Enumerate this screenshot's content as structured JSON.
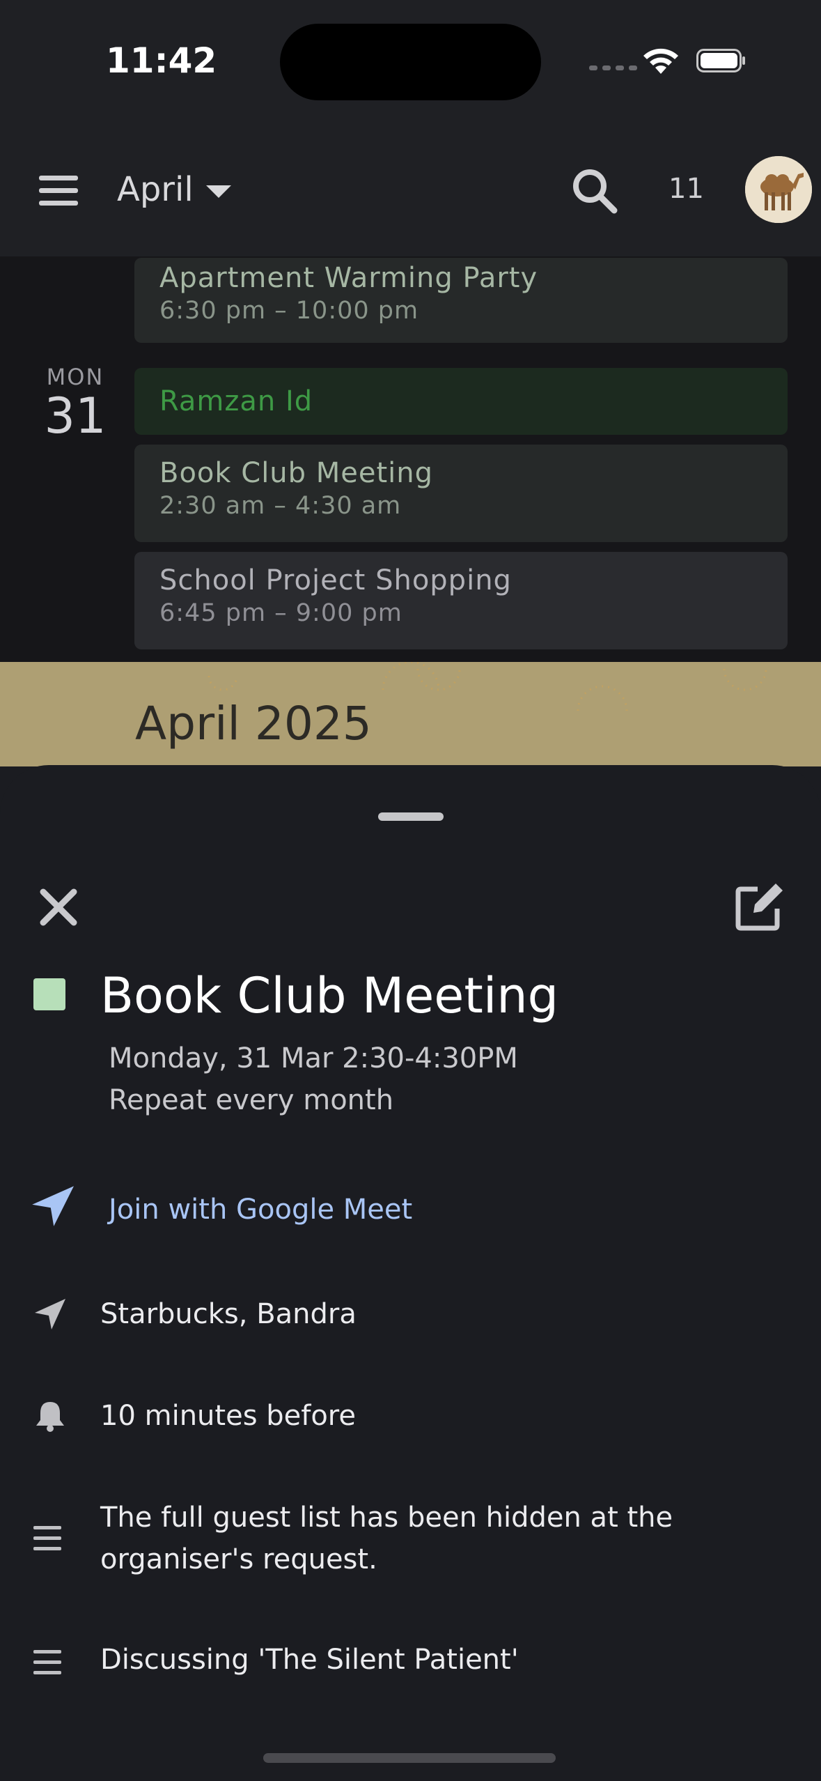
{
  "status_bar": {
    "time": "11:42"
  },
  "header": {
    "month": "April",
    "today_day": "11"
  },
  "agenda": {
    "partial_event": {
      "title": "Apartment Warming Party",
      "time": "6:30 pm – 10:00 pm"
    },
    "day": {
      "name": "MON",
      "number": "31"
    },
    "events": [
      {
        "title": "Ramzan Id",
        "time": ""
      },
      {
        "title": "Book Club Meeting",
        "time": "2:30 am – 4:30 am"
      },
      {
        "title": "School Project Shopping",
        "time": "6:45 pm – 9:00 pm"
      }
    ]
  },
  "month_banner": {
    "label": "April 2025"
  },
  "sheet": {
    "title": "Book Club Meeting",
    "color": "#b7dfb9",
    "date": "Monday, 31 Mar 2:30-4:30PM",
    "repeat": "Repeat every month",
    "meet_link": "Join with Google Meet",
    "location": "Starbucks, Bandra",
    "reminder": "10 minutes before",
    "guest_note": "The full guest list has been hidden at the organiser's request.",
    "description": "Discussing 'The Silent Patient'"
  },
  "colors": {
    "accent_link": "#a9c5f5",
    "holiday_green": "#3e9a45",
    "banner": "#ae9f73"
  },
  "icons": {
    "menu": "menu-icon",
    "search": "search-icon",
    "close": "close-icon",
    "edit": "edit-icon",
    "meet": "navigation-arrow-icon",
    "location": "location-arrow-icon",
    "reminder": "bell-icon",
    "notes": "notes-lines-icon"
  }
}
